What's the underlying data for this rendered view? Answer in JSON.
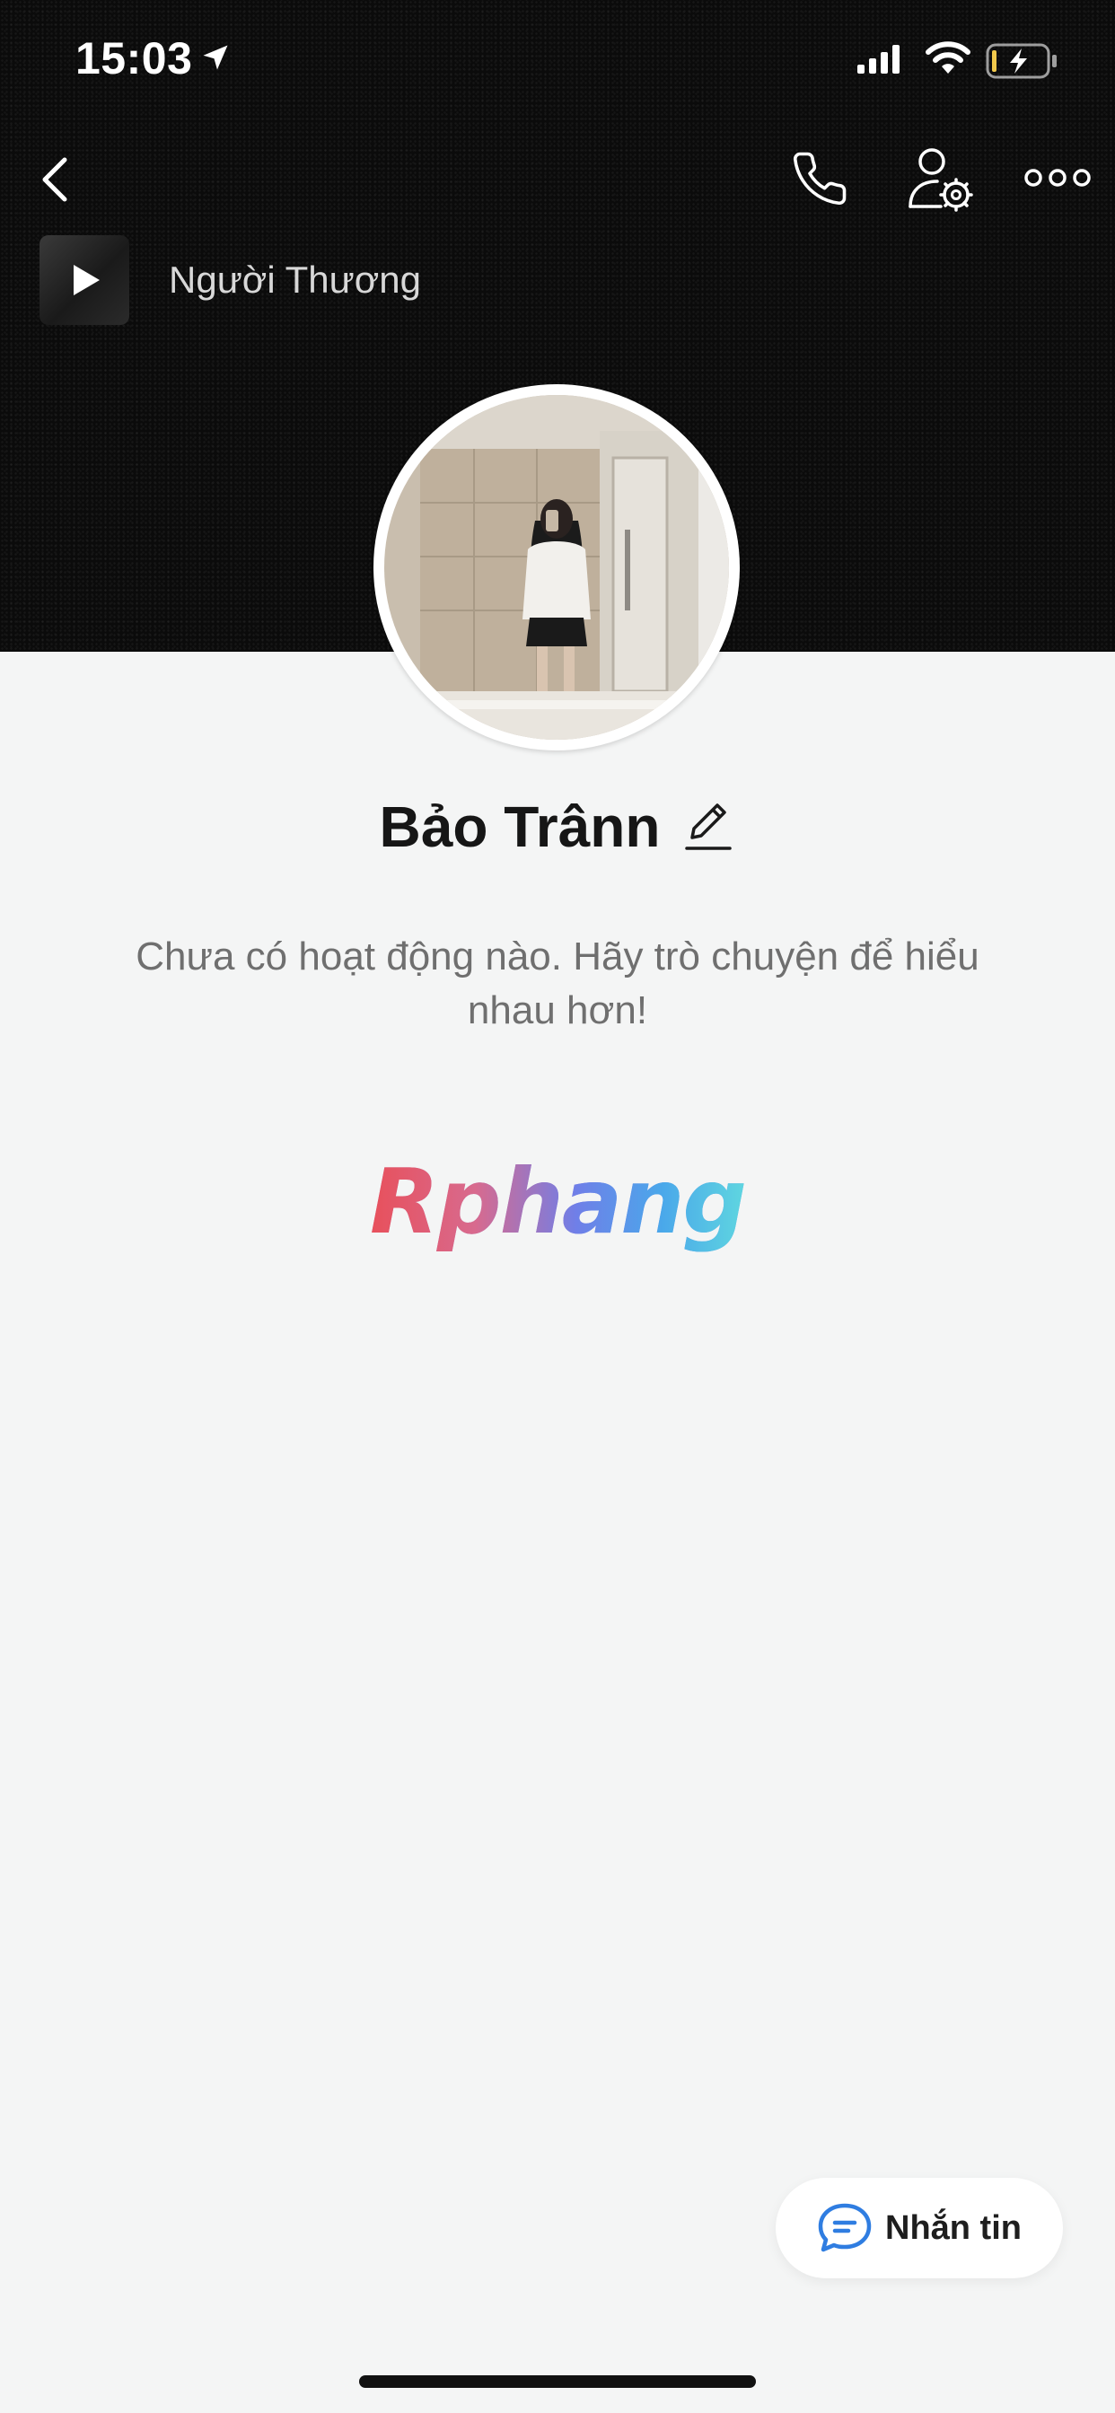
{
  "status_bar": {
    "time": "15:03",
    "icons": [
      "location-arrow-icon",
      "signal-bars-icon",
      "wifi-icon",
      "battery-charging-icon"
    ]
  },
  "nav": {
    "icons": [
      "chevron-left-icon",
      "phone-icon",
      "user-settings-icon",
      "more-dots-icon"
    ]
  },
  "music": {
    "song_title": "Người Thương",
    "icon": "play-icon"
  },
  "profile": {
    "name": "Bảo Trânn",
    "edit_icon": "pencil-icon",
    "empty_activity_text": "Chưa có hoạt động nào. Hãy trò chuyện để hiểu nhau hơn!"
  },
  "watermark": {
    "text": "Rphang"
  },
  "message_button": {
    "label": "Nhắn tin",
    "icon": "chat-bubble-icon"
  },
  "colors": {
    "cover_background": "#0b0b0b",
    "page_background": "#f4f5f5",
    "accent_blue": "#2f7de1",
    "text_primary": "#161616",
    "text_secondary": "#6f6f6f"
  }
}
